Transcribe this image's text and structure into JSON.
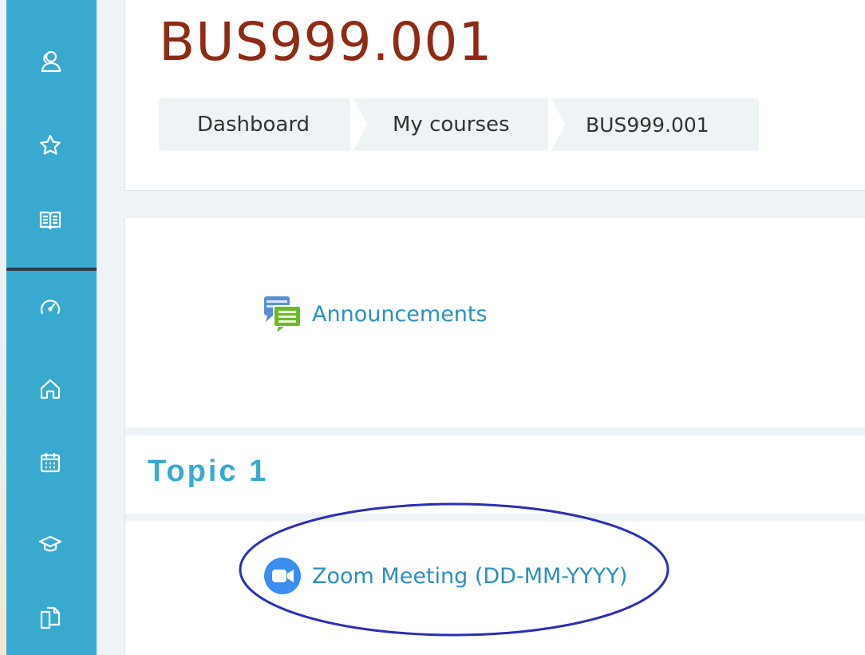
{
  "course": {
    "title": "BUS999.001"
  },
  "breadcrumb": {
    "items": [
      "Dashboard",
      "My courses",
      "BUS999.001"
    ]
  },
  "sidebar": {
    "icons": [
      "participants-icon",
      "star-icon",
      "book-icon",
      "dashboard-icon",
      "home-icon",
      "calendar-icon",
      "graduation-cap-icon",
      "files-icon"
    ]
  },
  "activities": {
    "announcements": "Announcements",
    "topic_title": "Topic 1",
    "zoom": "Zoom Meeting (DD-MM-YYYY)"
  },
  "colors": {
    "sidebar": "#3aa9d0",
    "title": "#8f2a14",
    "link": "#2b8fc1",
    "annotation": "#2a2fb8"
  }
}
